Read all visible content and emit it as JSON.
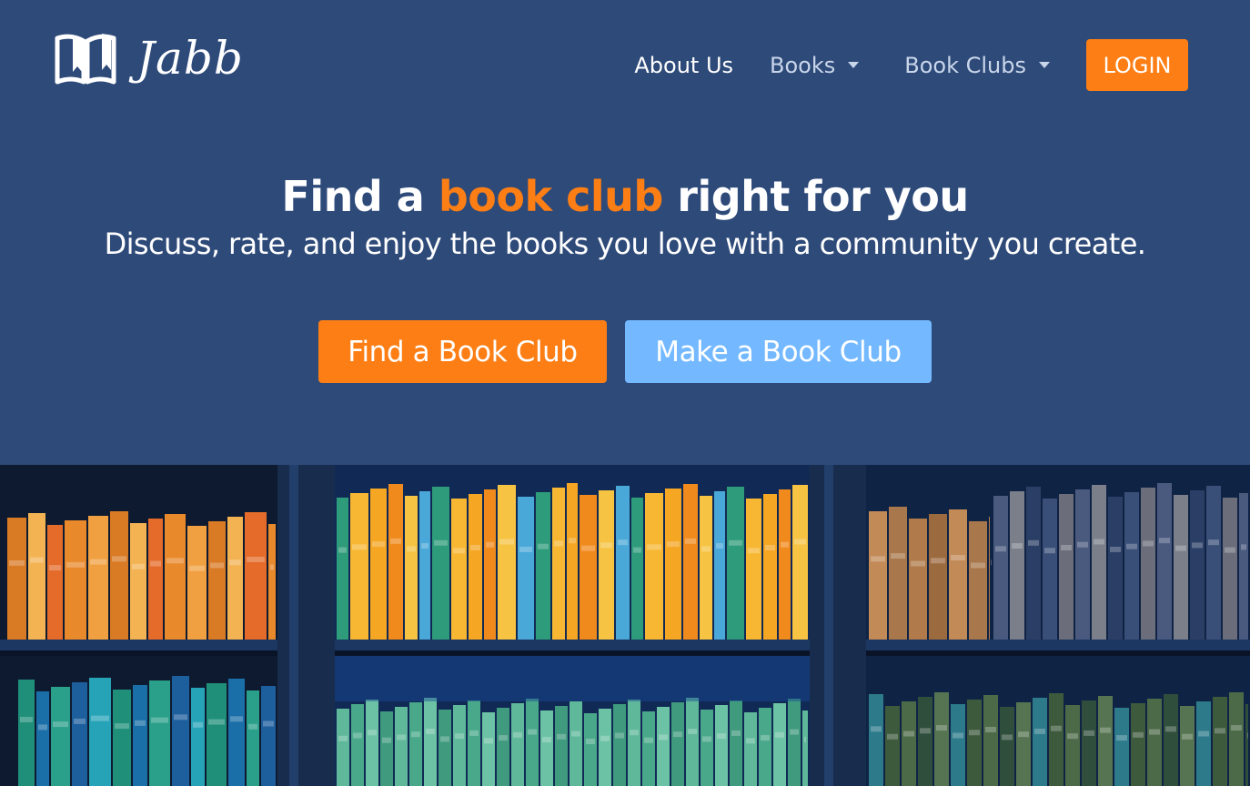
{
  "brand": {
    "name": "Jabb",
    "logo_icon": "open-book-icon"
  },
  "nav": {
    "about": "About Us",
    "books": "Books",
    "book_clubs": "Book Clubs",
    "login": "LOGIN"
  },
  "hero": {
    "title_before": "Find a ",
    "title_accent": "book club",
    "title_after": " right for you",
    "subtitle": "Discuss, rate, and enjoy the books you love with a community you create.",
    "find_button": "Find a Book Club",
    "make_button": "Make a Book Club"
  },
  "colors": {
    "background": "#2e4a79",
    "accent": "#fd7e14",
    "secondary": "#74b9ff"
  },
  "banner_image": "bookshelf-photo"
}
